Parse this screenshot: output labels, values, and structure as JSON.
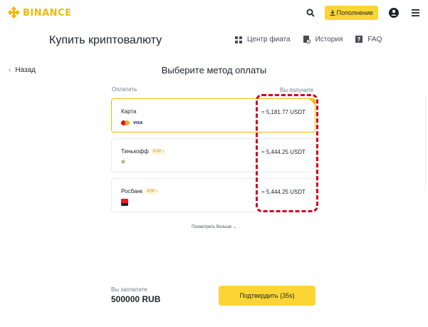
{
  "header": {
    "logo_text": "BINANCE",
    "deposit_label": "Пополнение",
    "accent": "#fcd535",
    "brand": "#f0b90b"
  },
  "subheader": {
    "title": "Купить криптовалюту",
    "nav": [
      {
        "label": "Центр фиата",
        "icon": "grid-icon"
      },
      {
        "label": "История",
        "icon": "history-icon"
      },
      {
        "label": "FAQ",
        "icon": "faq-icon"
      }
    ]
  },
  "section": {
    "back_label": "Назад",
    "title": "Выберите метод оплаты",
    "pay_col_label": "Оплатить",
    "get_col_label": "Вы получите"
  },
  "options": [
    {
      "name": "Карта",
      "tag": "",
      "amount": "≈ 5,181.77 USDT",
      "icons": [
        "mastercard-icon",
        "visa-icon"
      ],
      "visa_text": "VISA",
      "selected": true
    },
    {
      "name": "Тинькофф",
      "tag": "P2P",
      "amount": "≈ 5,444.25 USDT",
      "icons": [
        "bank-dot-icon"
      ],
      "selected": false
    },
    {
      "name": "Росбанк",
      "tag": "P2P",
      "amount": "≈ 5,444.25 USDT",
      "icons": [
        "rosbank-icon"
      ],
      "selected": false
    }
  ],
  "see_more": "Посмотреть больше",
  "footer": {
    "pay_label": "Вы заплатите",
    "pay_amount": "500000 RUB",
    "confirm_label": "Подтвердить (35s)"
  },
  "annotation_color": "#d0021b"
}
